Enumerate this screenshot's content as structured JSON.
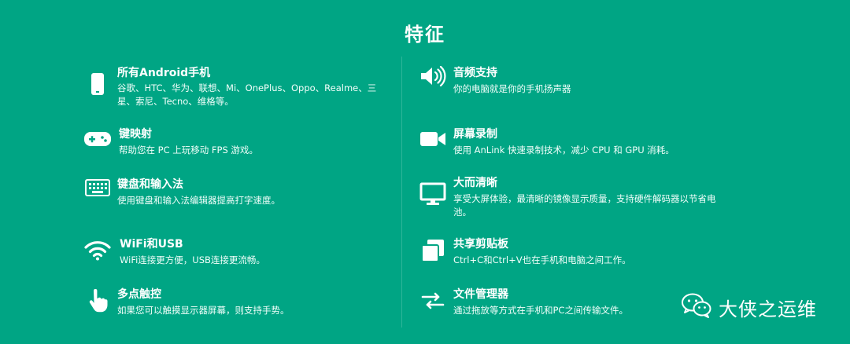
{
  "title": "特征",
  "features_left": [
    {
      "icon": "phone-icon",
      "title": "所有Android手机",
      "desc": "谷歌、HTC、华为、联想、Mi、OnePlus、Oppo、Realme、三星、索尼、Tecno、维格等。"
    },
    {
      "icon": "gamepad-icon",
      "title": "键映射",
      "desc": "帮助您在 PC 上玩移动 FPS 游戏。"
    },
    {
      "icon": "keyboard-icon",
      "title": "键盘和输入法",
      "desc": "使用键盘和输入法编辑器提高打字速度。"
    },
    {
      "icon": "wifi-icon",
      "title": "WiFi和USB",
      "desc": "WiFi连接更方便，USB连接更流畅。"
    },
    {
      "icon": "hand-pointer-icon",
      "title": "多点触控",
      "desc": "如果您可以触摸显示器屏幕，则支持手势。"
    }
  ],
  "features_right": [
    {
      "icon": "speaker-icon",
      "title": "音频支持",
      "desc": "你的电脑就是你的手机扬声器"
    },
    {
      "icon": "video-camera-icon",
      "title": "屏幕录制",
      "desc": "使用 AnLink 快速录制技术，减少 CPU 和 GPU 消耗。"
    },
    {
      "icon": "monitor-icon",
      "title": "大而清晰",
      "desc": "享受大屏体验，最清晰的镜像显示质量，支持硬件解码器以节省电池。"
    },
    {
      "icon": "clipboard-icon",
      "title": "共享剪贴板",
      "desc": "Ctrl+C和Ctrl+V也在手机和电脑之间工作。"
    },
    {
      "icon": "transfer-arrows-icon",
      "title": "文件管理器",
      "desc": "通过拖放等方式在手机和PC之间传输文件。"
    }
  ],
  "watermark": {
    "icon": "wechat-icon",
    "text": "大侠之运维"
  },
  "colors": {
    "background": "#00a584",
    "text": "#ffffff"
  }
}
